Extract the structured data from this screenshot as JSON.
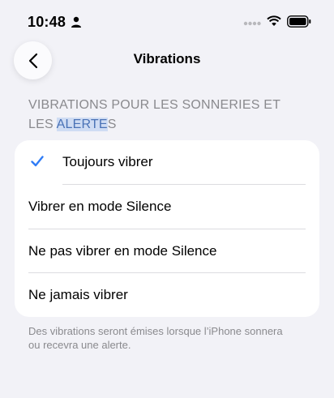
{
  "status_bar": {
    "time": "10:48"
  },
  "nav": {
    "title": "Vibrations"
  },
  "section": {
    "header_prefix": "VIBRATIONS POUR LES SONNERIES ET LES ",
    "header_selected": "ALERTE",
    "header_suffix": "S"
  },
  "options": [
    {
      "label": "Toujours vibrer",
      "checked": true
    },
    {
      "label": "Vibrer en mode Silence",
      "checked": false
    },
    {
      "label": "Ne pas vibrer en mode Silence",
      "checked": false
    },
    {
      "label": "Ne jamais vibrer",
      "checked": false
    }
  ],
  "footer": {
    "note": "Des vibrations seront émises lorsque l’iPhone sonnera ou recevra une alerte."
  },
  "colors": {
    "accent": "#2f7cf6",
    "background": "#f2f2f7",
    "selection": "#cfdcf3"
  }
}
